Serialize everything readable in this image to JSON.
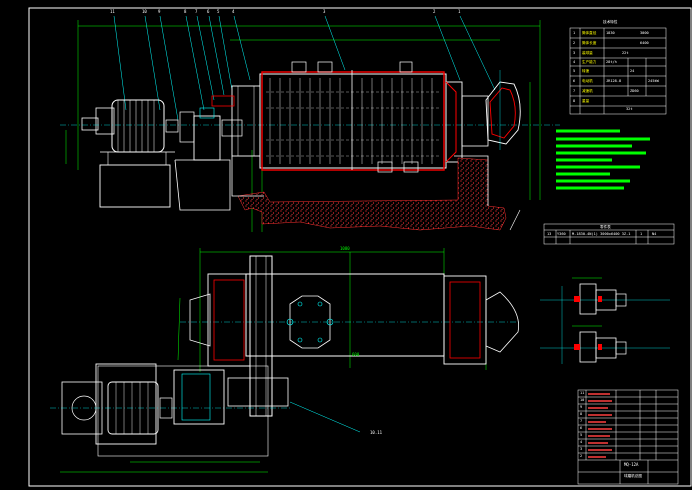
{
  "drawing": {
    "top_callouts": [
      "11",
      "10",
      "9",
      "8",
      "7",
      "6",
      "5",
      "4",
      "3",
      "2",
      "1"
    ],
    "dimension_text": {
      "top_overall": "",
      "plan_overall": "1080",
      "plan_right": "600",
      "plan_bottom": "",
      "plan_bottom_left": ""
    },
    "plan_callout": "10.11"
  },
  "spec_table": {
    "title": "技术特性",
    "rows": [
      [
        "1",
        "筒体直径",
        "1830",
        "3000"
      ],
      [
        "2",
        "筒体长度",
        "",
        "6400"
      ],
      [
        "3",
        "装球量",
        "",
        "22t"
      ],
      [
        "4",
        "生产能力",
        "",
        "28t/h"
      ],
      [
        "5",
        "转速",
        "",
        "24"
      ],
      [
        "6",
        "电动机",
        "JR128-8",
        "245kW"
      ],
      [
        "7",
        "减速机",
        "",
        "ZD60"
      ],
      [
        "8",
        "重量",
        "",
        "32t"
      ]
    ]
  },
  "parts_strip": {
    "title": "零件表",
    "cells": [
      "13",
      "Y360",
      "M-1830-4N(1) 3000x6400 3Z-1",
      "1",
      "N4"
    ]
  },
  "bom": {
    "rows": [
      "11",
      "10",
      "9",
      "8",
      "7",
      "6",
      "5",
      "4",
      "3",
      "2",
      "1"
    ],
    "title_block": {
      "drawing_no": "MQ-12A",
      "name": "球磨机总图"
    }
  },
  "colors": {
    "line": "#ffffff",
    "dim": "#00ff00",
    "cyan": "#00ffff",
    "red": "#ff0000",
    "yellow": "#ffff00",
    "hatch": "#ff3030"
  }
}
